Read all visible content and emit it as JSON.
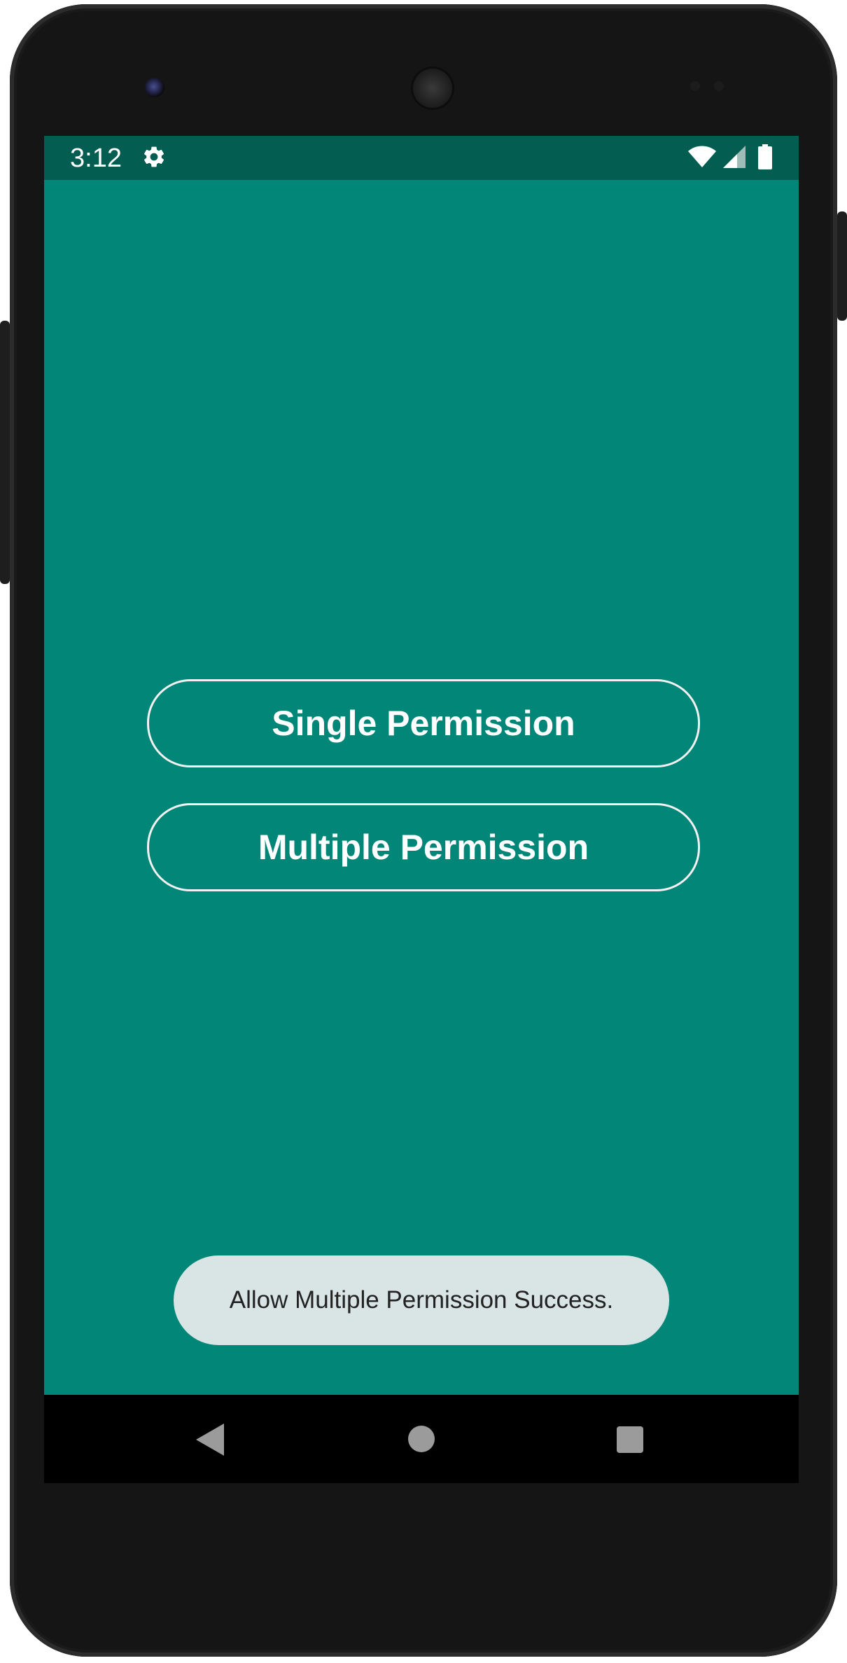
{
  "status_bar": {
    "time": "3:12",
    "icons": [
      "gear-icon",
      "wifi-icon",
      "cell-signal-icon",
      "battery-icon"
    ]
  },
  "buttons": {
    "single_label": "Single Permission",
    "multiple_label": "Multiple Permission"
  },
  "toast": {
    "message": "Allow Multiple Permission Success."
  },
  "nav_bar": {
    "icons": [
      "back-icon",
      "home-icon",
      "recents-icon"
    ]
  },
  "colors": {
    "background": "#028677",
    "status_bar": "#035e51",
    "button_border": "#f2f2f2",
    "toast_background": "#d8e5e4",
    "nav_bar": "#000000"
  }
}
